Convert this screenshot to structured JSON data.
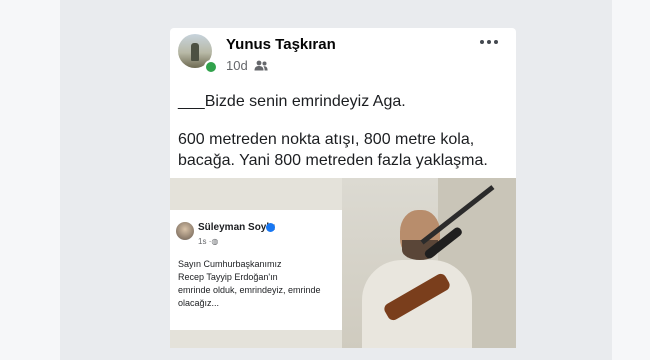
{
  "post": {
    "author": "Yunus Taşkıran",
    "time": "10d",
    "audience_icon": "friends-icon",
    "more_icon": "more-options-icon",
    "lines": [
      "___Bizde senin emrindeyiz Aga.",
      "600 metreden nokta atışı, 800 metre kola,",
      "bacağa. Yani 800 metreden fazla yaklaşma."
    ]
  },
  "embedded_post": {
    "author": "Süleyman Soylu",
    "time": "1s",
    "audience_icon": "globe-icon",
    "lines": [
      "Sayın Cumhurbaşkanımız",
      "Recep Tayyip Erdoğan'ın",
      "emrinde olduk, emrindeyiz, emrinde",
      "olacağız..."
    ]
  },
  "colors": {
    "page_background": "#e9ebee",
    "card_background": "#ffffff",
    "online_indicator": "#31a24c",
    "verified_badge": "#1877f2",
    "meta_text": "#65676b"
  }
}
